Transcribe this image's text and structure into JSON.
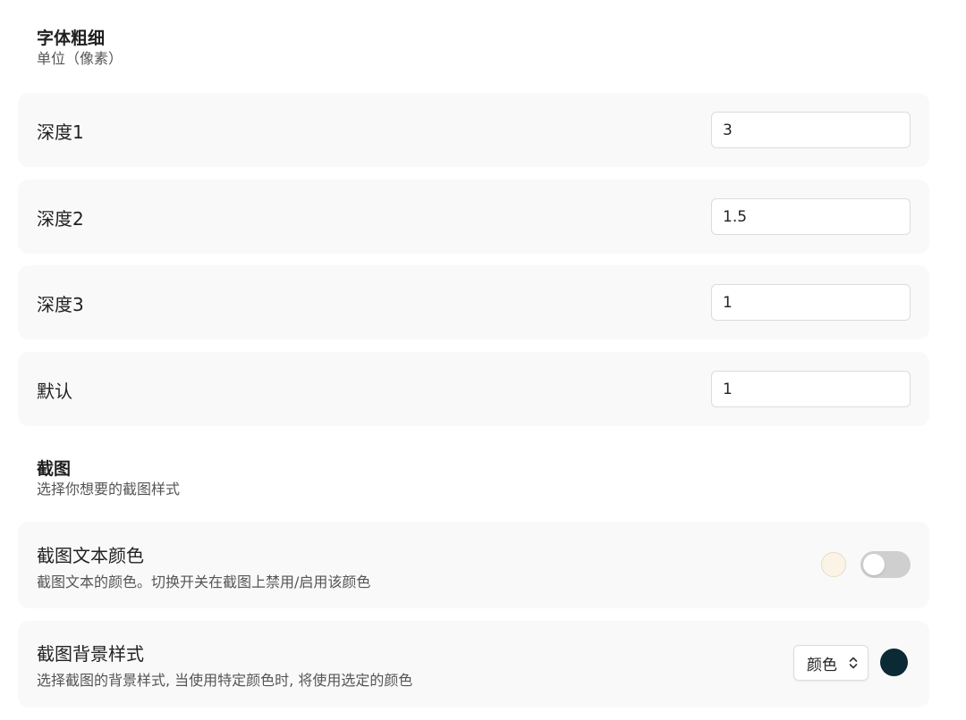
{
  "font_weight_section": {
    "title": "字体粗细",
    "subtitle": "单位（像素）",
    "rows": [
      {
        "label": "深度1",
        "value": "3"
      },
      {
        "label": "深度2",
        "value": "1.5"
      },
      {
        "label": "深度3",
        "value": "1"
      },
      {
        "label": "默认",
        "value": "1"
      }
    ]
  },
  "screenshot_section": {
    "title": "截图",
    "subtitle": "选择你想要的截图样式",
    "text_color_item": {
      "title": "截图文本颜色",
      "description": "截图文本的颜色。切换开关在截图上禁用/启用该颜色",
      "swatch_color": "#fbf4e6",
      "toggle_on": false
    },
    "background_item": {
      "title": "截图背景样式",
      "description": "选择截图的背景样式, 当使用特定颜色时, 将使用选定的颜色",
      "select_value": "颜色",
      "swatch_color": "#0b2a36"
    }
  },
  "icons": {
    "select_chevron": "chevron-up-down-icon"
  }
}
